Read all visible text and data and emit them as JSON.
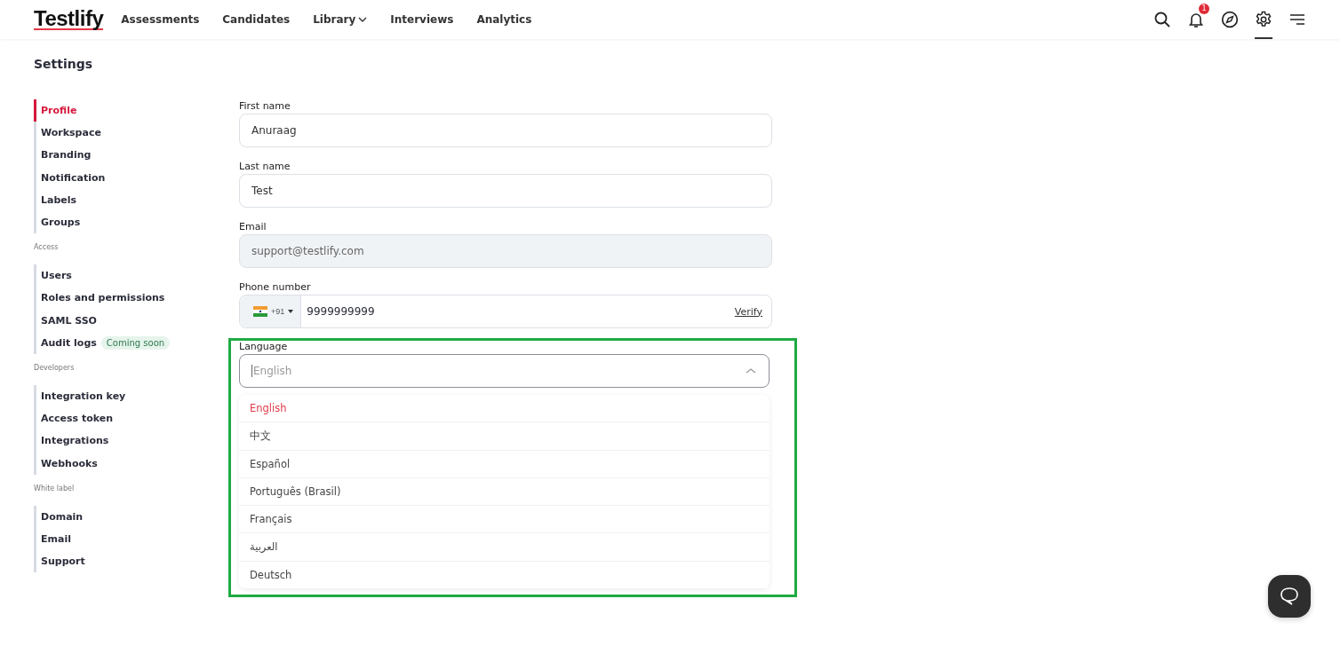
{
  "header": {
    "logo": "Testlify",
    "nav": [
      {
        "label": "Assessments",
        "kind": "link"
      },
      {
        "label": "Candidates",
        "kind": "link"
      },
      {
        "label": "Library",
        "kind": "dropdown"
      },
      {
        "label": "Interviews",
        "kind": "link"
      },
      {
        "label": "Analytics",
        "kind": "link"
      }
    ],
    "tools": [
      {
        "kind": "search",
        "selected": false
      },
      {
        "kind": "bell",
        "selected": false,
        "badge": "1"
      },
      {
        "kind": "compass",
        "selected": false
      },
      {
        "kind": "settings",
        "selected": true
      },
      {
        "kind": "menu",
        "selected": false
      }
    ]
  },
  "page_title": "Settings",
  "sidebar": {
    "groups": [
      {
        "items": [
          {
            "label": "Profile",
            "selected": true
          },
          {
            "label": "Workspace",
            "selected": false
          },
          {
            "label": "Branding",
            "selected": false
          },
          {
            "label": "Notification",
            "selected": false
          },
          {
            "label": "Labels",
            "selected": false
          },
          {
            "label": "Groups",
            "selected": false
          }
        ]
      },
      {
        "heading": "Access",
        "items": [
          {
            "label": "Users",
            "selected": false
          },
          {
            "label": "Roles and permissions",
            "selected": false
          },
          {
            "label": "SAML SSO",
            "selected": false
          },
          {
            "label": "Audit logs",
            "selected": false,
            "badge": "Coming soon"
          }
        ]
      },
      {
        "heading": "Developers",
        "items": [
          {
            "label": "Integration key",
            "selected": false
          },
          {
            "label": "Access token",
            "selected": false
          },
          {
            "label": "Integrations",
            "selected": false
          },
          {
            "label": "Webhooks",
            "selected": false
          }
        ]
      },
      {
        "heading": "White label",
        "items": [
          {
            "label": "Domain",
            "selected": false
          },
          {
            "label": "Email",
            "selected": false
          },
          {
            "label": "Support",
            "selected": false
          }
        ]
      }
    ]
  },
  "form": {
    "fields": [
      {
        "label": "First name",
        "value": "Anuraag",
        "disabled": false
      },
      {
        "label": "Last name",
        "value": "Test",
        "disabled": false
      },
      {
        "label": "Email",
        "value": "support@testlify.com",
        "disabled": true
      }
    ],
    "phone": {
      "label": "Phone number",
      "code": "+91",
      "value": "9999999999",
      "action": "Verify"
    },
    "language": {
      "label": "Language",
      "placeholder": "English",
      "expanded": true,
      "options": [
        {
          "label": "English",
          "selected": true
        },
        {
          "label": "中文",
          "selected": false
        },
        {
          "label": "Español",
          "selected": false
        },
        {
          "label": "Português (Brasil)",
          "selected": false
        },
        {
          "label": "Français",
          "selected": false
        },
        {
          "label": "العربية",
          "selected": false
        },
        {
          "label": "Deutsch",
          "selected": false
        }
      ]
    }
  }
}
